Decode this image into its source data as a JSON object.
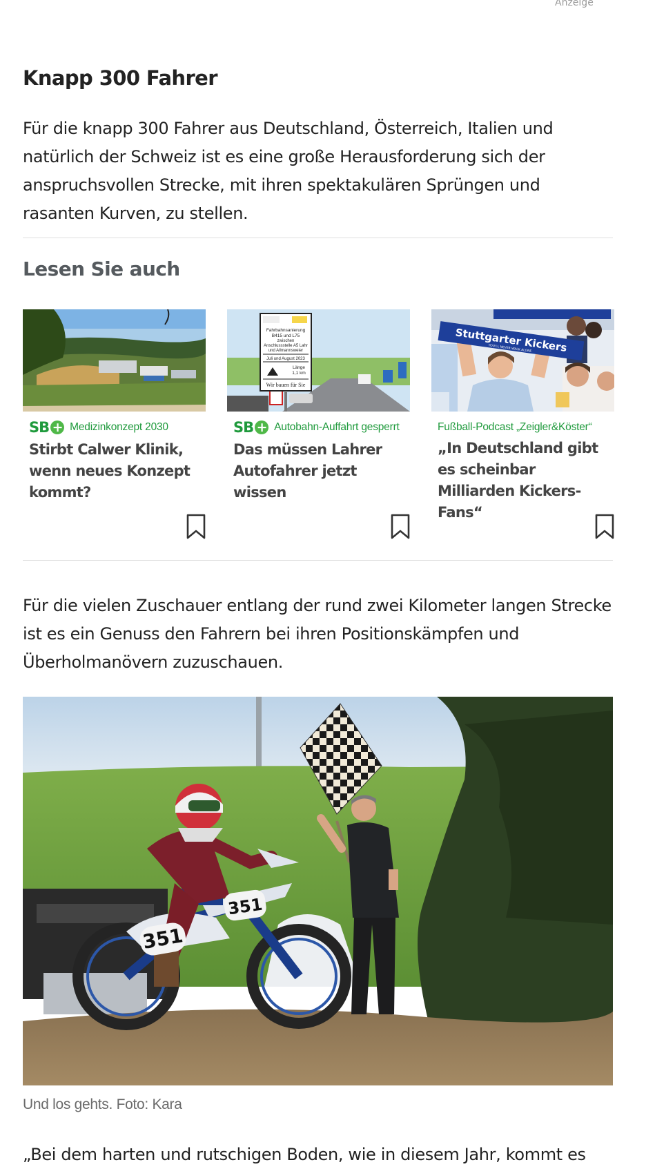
{
  "ad": {
    "label": "Anzeige"
  },
  "article": {
    "section_heading": "Knapp 300 Fahrer",
    "paragraph1": "Für die knapp 300 Fahrer aus Deutschland, Österreich, Italien und natürlich der Schweiz ist es eine große Herausforderung sich der anspruchsvollen Strecke, mit ihren spektakulären Sprüngen und rasanten Kurven, zu stellen.",
    "paragraph2": "Für die vielen Zuschauer entlang der rund zwei Kilometer langen Strecke ist es ein Genuss den Fahrern bei ihren Positionskämpfen und Überholmanövern zuzuschauen.",
    "photo_caption": "Und los gehts. Foto: Kara",
    "paragraph3": "„Bei dem harten und rutschigen Boden, wie in diesem Jahr, kommt es"
  },
  "read_also": {
    "title": "Lesen Sie auch",
    "cards": [
      {
        "badge": "SB",
        "kicker": "Medizinkonzept 2030",
        "headline": "Stirbt Calwer Klinik, wenn neues Konzept kommt?"
      },
      {
        "badge": "SB",
        "kicker": "Autobahn-Auffahrt gesperrt",
        "headline": "Das müssen Lahrer Autofahrer jetzt wissen",
        "sign": {
          "l1": "Fahrbahnsanierung",
          "l2": "B415 und L75",
          "l3": "zwischen",
          "l4": "Anschlussstelle A5 Lahr",
          "l5": "und Allmannsweier",
          "l6": "Juli und August 2023",
          "l7": "Länge",
          "l8": "1,1 km",
          "l9": "Wir bauen für Sie"
        }
      },
      {
        "badge": "",
        "kicker": "Fußball-Podcast „Zeigler&Köster“",
        "headline": "„In Deutschland gibt es scheinbar Milliarden Kickers-Fans“",
        "scarf": "Stuttgarter Kickers",
        "scarf_sub": "YOU'LL NEVER WALK ALONE"
      }
    ]
  },
  "photo": {
    "bike_number": "351"
  },
  "colors": {
    "accent_green": "#1f9a3c",
    "plus_green": "#4fb848",
    "divider": "#dedede"
  }
}
